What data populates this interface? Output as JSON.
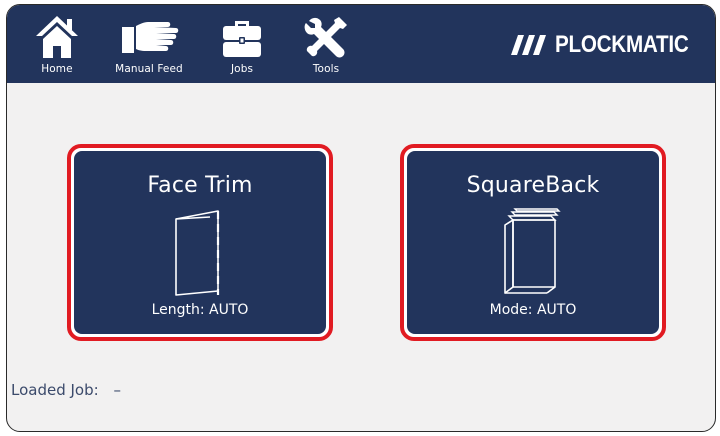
{
  "nav": {
    "items": [
      {
        "label": "Home",
        "icon": "home-icon"
      },
      {
        "label": "Manual Feed",
        "icon": "hand-icon"
      },
      {
        "label": "Jobs",
        "icon": "briefcase-icon"
      },
      {
        "label": "Tools",
        "icon": "tools-icon"
      }
    ]
  },
  "brand": {
    "logo_text": "PLOCKMATIC",
    "logo_icon": "triple-slash-icon"
  },
  "functions": {
    "face_trim": {
      "title": "Face Trim",
      "status": "Length: AUTO",
      "icon": "open-booklet-icon"
    },
    "square_back": {
      "title": "SquareBack",
      "status": "Mode: AUTO",
      "icon": "book-stack-icon"
    }
  },
  "loaded_job": {
    "label": "Loaded Job:",
    "value": "–"
  },
  "colors": {
    "nav_background": "#22345c",
    "card_background": "#22345c",
    "card_selected_border": "#e11b22",
    "screen_background": "#f2f1f1"
  }
}
